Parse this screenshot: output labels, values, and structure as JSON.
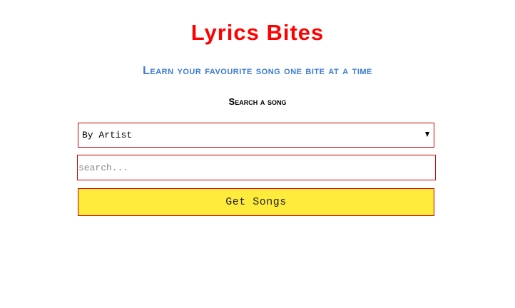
{
  "app": {
    "title": "Lyrics Bites",
    "subtitle": "Learn your favourite song one bite at a time"
  },
  "search": {
    "heading": "Search a song",
    "mode_select": {
      "selected": "By Artist",
      "options": [
        "By Artist"
      ]
    },
    "query": {
      "value": "",
      "placeholder": "search..."
    },
    "submit_label": "Get Songs"
  },
  "colors": {
    "title": "#ff0000",
    "subtitle": "#3a7bd5",
    "field_border": "#cc0000",
    "button_background": "#ffeb3b"
  }
}
